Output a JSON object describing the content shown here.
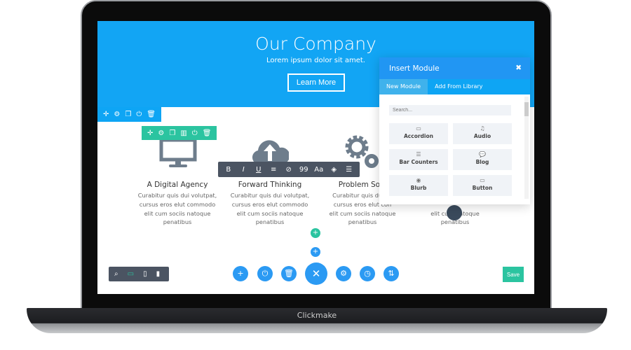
{
  "laptop": {
    "brand": "Clickmake"
  },
  "hero": {
    "title": "Our Company",
    "subtitle": "Lorem ipsum dolor sit amet.",
    "button": "Learn More"
  },
  "columns": [
    {
      "title": "A Digital Agency",
      "icon": "monitor-icon",
      "lines": [
        "Curabitur quis dui volutpat,",
        "cursus eros elut commodo",
        "elit cum sociis natoque",
        "penatibus"
      ]
    },
    {
      "title": "Forward Thinking",
      "icon": "cloud-upload-icon",
      "lines": [
        "Curabitur quis dui volutpat,",
        "cursus eros elut commodo",
        "elit cum sociis natoque",
        "penatibus"
      ]
    },
    {
      "title": "Problem Solv",
      "icon": "gears-icon",
      "lines": [
        "Curabitur quis dui vo",
        "cursus eros elut con",
        "elit cum sociis natoque",
        "penatibus"
      ]
    },
    {
      "title": "",
      "icon": "",
      "lines": [
        "",
        "",
        "elit cum    natoque",
        "penatibus"
      ]
    }
  ],
  "text_toolbar": [
    "B",
    "I",
    "U",
    "≡",
    "⊘",
    "99",
    "Aa",
    "◈",
    "☰"
  ],
  "modal": {
    "title": "Insert Module",
    "close": "✖",
    "tabs": [
      "New Module",
      "Add From Library"
    ],
    "search_placeholder": "Search...",
    "modules": [
      {
        "label": "Accordion",
        "icon": "▭"
      },
      {
        "label": "Audio",
        "icon": "♫"
      },
      {
        "label": "Bar Counters",
        "icon": "☰"
      },
      {
        "label": "Blog",
        "icon": "💬"
      },
      {
        "label": "Blurb",
        "icon": "◉"
      },
      {
        "label": "Button",
        "icon": "▭"
      }
    ]
  },
  "bottom": {
    "save": "Save"
  },
  "colors": {
    "hero": "#12a5f4",
    "row_toolbar": "#2bc4a0",
    "section_toolbar": "#0ea5f4",
    "action": "#2b9af3",
    "save": "#2bc4a0"
  }
}
